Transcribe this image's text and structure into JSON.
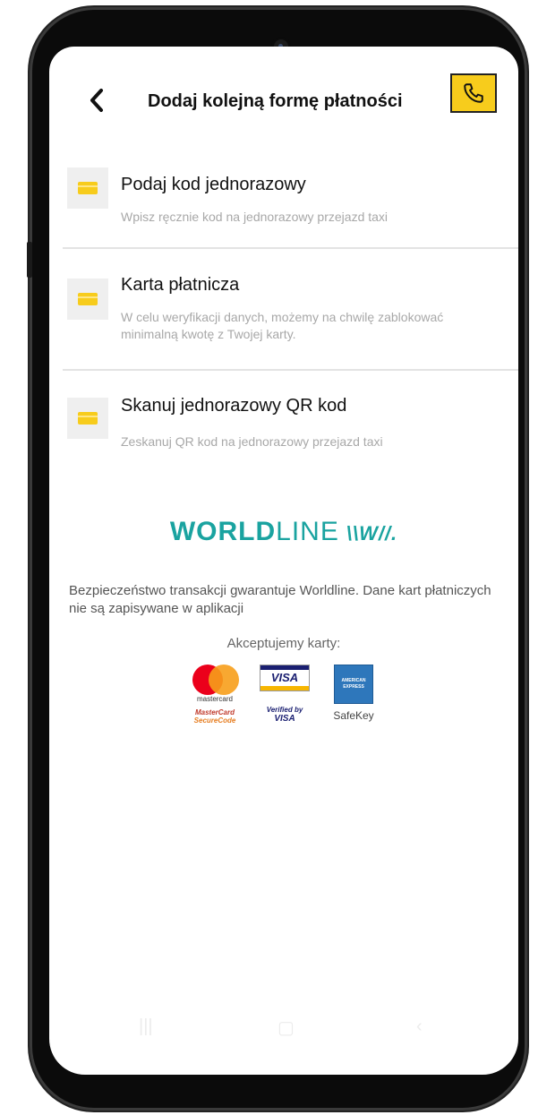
{
  "header": {
    "title": "Dodaj kolejną formę płatności"
  },
  "options": [
    {
      "title": "Podaj kod jednorazowy",
      "description": "Wpisz ręcznie kod na jednorazowy przejazd taxi"
    },
    {
      "title": "Karta płatnicza",
      "description": "W celu weryfikacji danych, możemy na chwilę zablokować minimalną kwotę z Twojej karty."
    },
    {
      "title": "Skanuj jednorazowy QR kod",
      "description": "Zeskanuj QR kod na jednorazowy przejazd taxi"
    }
  ],
  "worldline": {
    "bold": "WORLD",
    "light": "LINE",
    "mark": "\\\\W//."
  },
  "security_text": "Bezpieczeństwo transakcji gwarantuje Worldline. Dane kart płatniczych nie są zapisywane w aplikacji",
  "accept_text": "Akceptujemy karty:",
  "card_logos": {
    "mastercard": "mastercard",
    "mastercard_secure_1": "MasterCard",
    "mastercard_secure_2": "SecureCode",
    "visa": "VISA",
    "verified_1": "Verified by",
    "verified_2": "VISA",
    "amex_1": "AMERICAN",
    "amex_2": "EXPRESS",
    "safekey": "SafeKey"
  },
  "colors": {
    "accent_yellow": "#f7cc1c",
    "worldline_teal": "#1aa3a0"
  }
}
